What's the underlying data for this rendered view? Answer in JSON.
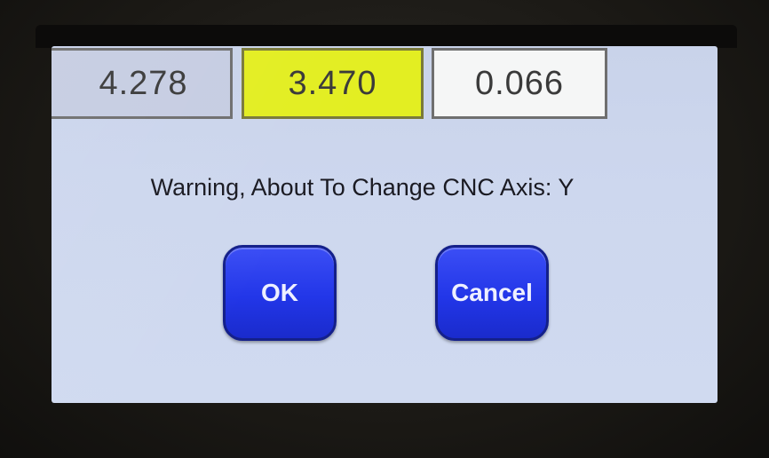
{
  "readouts": {
    "x_value": "4.278",
    "y_value": "3.470",
    "z_value": "0.066",
    "active_color": "#e3ee22"
  },
  "dialog": {
    "message": "Warning, About To Change CNC Axis: Y",
    "ok_label": "OK",
    "cancel_label": "Cancel",
    "button_color": "#2236e8"
  },
  "colors": {
    "screen_background": "#cdd7ee",
    "bezel": "#1c1a17"
  }
}
